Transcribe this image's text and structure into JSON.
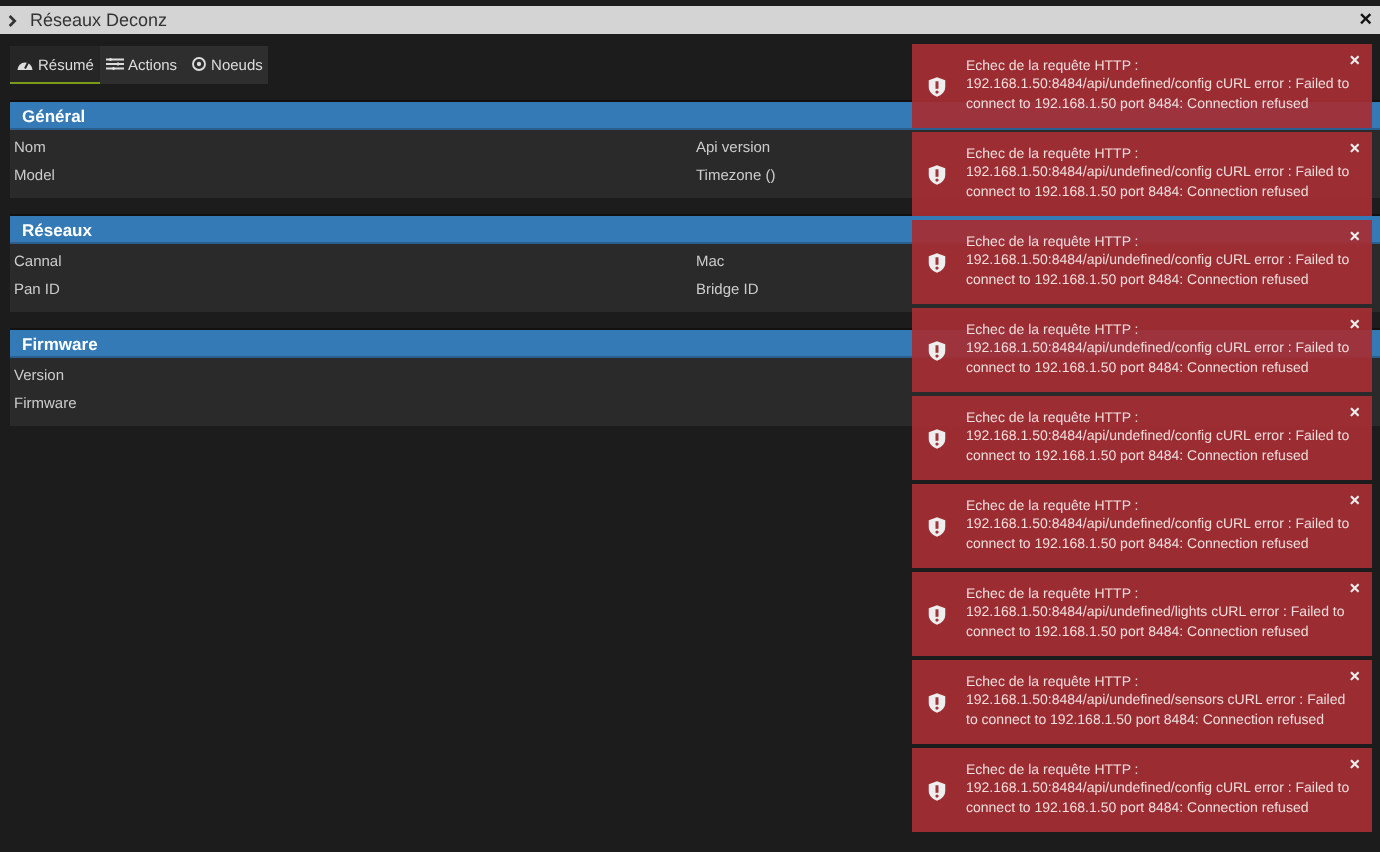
{
  "window": {
    "title": "Réseaux Deconz",
    "close": "×"
  },
  "tabs": [
    {
      "label": "Résumé",
      "selected": true
    },
    {
      "label": "Actions",
      "selected": false
    },
    {
      "label": "Noeuds",
      "selected": false
    }
  ],
  "panels": [
    {
      "title": "Général",
      "fields": [
        {
          "left": "Nom",
          "right": "Api version"
        },
        {
          "left": "Model",
          "right": "Timezone ()"
        }
      ]
    },
    {
      "title": "Réseaux",
      "fields": [
        {
          "left": "Cannal",
          "right": "Mac"
        },
        {
          "left": "Pan ID",
          "right": "Bridge ID"
        }
      ]
    },
    {
      "title": "Firmware",
      "fields": [
        {
          "left": "Version"
        },
        {
          "left": "Firmware"
        }
      ]
    }
  ],
  "notifications": [
    {
      "title": "Echec de la requête HTTP :",
      "message": "192.168.1.50:8484/api/undefined/config cURL error : Failed to connect to 192.168.1.50 port 8484: Connection refused",
      "close": "×"
    },
    {
      "title": "Echec de la requête HTTP :",
      "message": "192.168.1.50:8484/api/undefined/config cURL error : Failed to connect to 192.168.1.50 port 8484: Connection refused",
      "close": "×"
    },
    {
      "title": "Echec de la requête HTTP :",
      "message": "192.168.1.50:8484/api/undefined/config cURL error : Failed to connect to 192.168.1.50 port 8484: Connection refused",
      "close": "×"
    },
    {
      "title": "Echec de la requête HTTP :",
      "message": "192.168.1.50:8484/api/undefined/config cURL error : Failed to connect to 192.168.1.50 port 8484: Connection refused",
      "close": "×"
    },
    {
      "title": "Echec de la requête HTTP :",
      "message": "192.168.1.50:8484/api/undefined/config cURL error : Failed to connect to 192.168.1.50 port 8484: Connection refused",
      "close": "×"
    },
    {
      "title": "Echec de la requête HTTP :",
      "message": "192.168.1.50:8484/api/undefined/config cURL error : Failed to connect to 192.168.1.50 port 8484: Connection refused",
      "close": "×"
    },
    {
      "title": "Echec de la requête HTTP :",
      "message": "192.168.1.50:8484/api/undefined/lights cURL error : Failed to connect to 192.168.1.50 port 8484: Connection refused",
      "close": "×"
    },
    {
      "title": "Echec de la requête HTTP :",
      "message": "192.168.1.50:8484/api/undefined/sensors cURL error : Failed to connect to 192.168.1.50 port 8484: Connection refused",
      "close": "×"
    },
    {
      "title": "Echec de la requête HTTP :",
      "message": "192.168.1.50:8484/api/undefined/config cURL error : Failed to connect to 192.168.1.50 port 8484: Connection refused",
      "close": "×"
    }
  ]
}
